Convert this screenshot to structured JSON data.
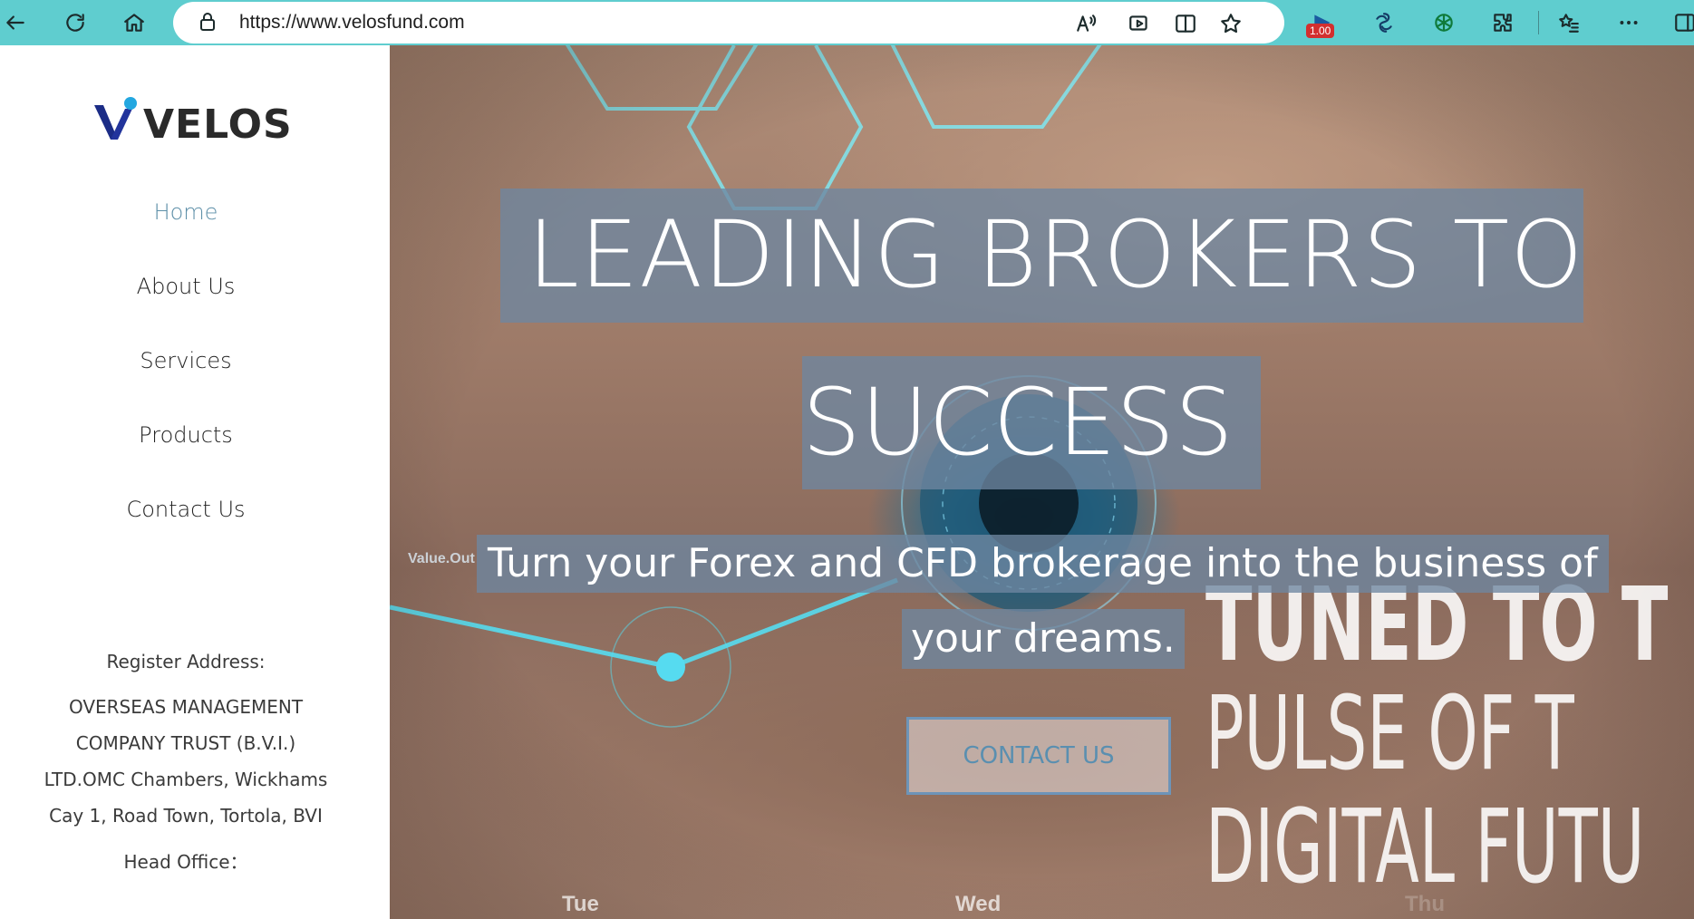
{
  "browser": {
    "url": "https://www.velosfund.com",
    "badge": "1.00"
  },
  "sidebar": {
    "logo_text": "VELOS",
    "menu": [
      {
        "label": "Home",
        "active": true
      },
      {
        "label": "About Us",
        "active": false
      },
      {
        "label": "Services",
        "active": false
      },
      {
        "label": "Products",
        "active": false
      },
      {
        "label": "Contact Us",
        "active": false
      }
    ],
    "register_label": "Register Address:",
    "address_lines": [
      "OVERSEAS MANAGEMENT",
      "COMPANY TRUST (B.V.I.)",
      "LTD.OMC Chambers, Wickhams",
      "Cay 1, Road Town, Tortola, BVI"
    ],
    "head_office_label": "Head Office："
  },
  "hero": {
    "headline_line1": "LEADING BROKERS TO",
    "headline_line2": "SUCCESS",
    "subtitle_line1": "Turn your Forex and CFD brokerage into the business of",
    "subtitle_line2": "your dreams.",
    "cta_label": "CONTACT US",
    "overlay_text": [
      "TUNED TO T",
      "PULSE OF T",
      "DIGITAL FUTU"
    ],
    "value_tag": "Value.Out",
    "days": [
      "Tue",
      "Wed",
      "Thu"
    ]
  },
  "colors": {
    "chrome": "#5fcdcf",
    "active_menu": "#5d8fa8",
    "text_band": "#6e87a0",
    "cta_border": "#6d94b8"
  }
}
